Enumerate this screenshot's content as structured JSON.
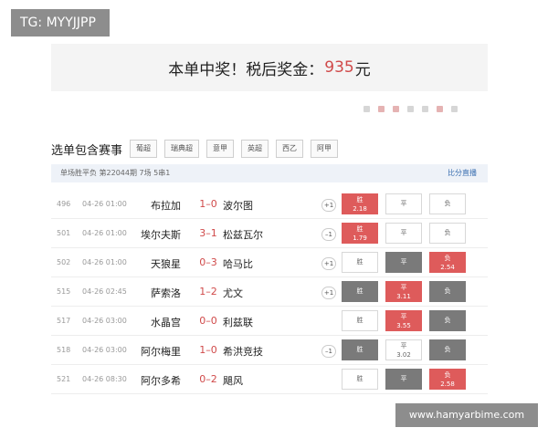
{
  "watermark": {
    "tg": "TG: MYYJJPP",
    "site": "www.hamyarbime.com"
  },
  "banner": {
    "prefix": "本单中奖！税后奖金：",
    "amount": "935",
    "suffix": "元"
  },
  "section": {
    "title": "选单包含赛事",
    "leagues": [
      "葡超",
      "瑞典超",
      "意甲",
      "英超",
      "西乙",
      "阿甲"
    ]
  },
  "subheader": {
    "left": "单场胜平负 第22044期 7场 5串1",
    "right": "比分直播"
  },
  "colors": {
    "red": "#de5b5b",
    "gray": "#7a7a7a",
    "score_red": "#d04a4a"
  },
  "matches": [
    {
      "num": "496",
      "time": "04-26 01:00",
      "home": "布拉加",
      "score": "1–0",
      "away": "波尔图",
      "hcap": "+1",
      "odds": [
        {
          "label": "胜",
          "value": "2.18",
          "state": "red"
        },
        {
          "label": "平",
          "value": "",
          "state": "white"
        },
        {
          "label": "负",
          "value": "",
          "state": "white"
        }
      ]
    },
    {
      "num": "501",
      "time": "04-26 01:00",
      "home": "埃尔夫斯",
      "score": "3–1",
      "away": "松兹瓦尔",
      "hcap": "–1",
      "odds": [
        {
          "label": "胜",
          "value": "1.79",
          "state": "red"
        },
        {
          "label": "平",
          "value": "",
          "state": "white"
        },
        {
          "label": "负",
          "value": "",
          "state": "white"
        }
      ]
    },
    {
      "num": "502",
      "time": "04-26 01:00",
      "home": "天狼星",
      "score": "0–3",
      "away": "哈马比",
      "hcap": "+1",
      "odds": [
        {
          "label": "胜",
          "value": "",
          "state": "white"
        },
        {
          "label": "平",
          "value": "",
          "state": "gray"
        },
        {
          "label": "负",
          "value": "2.54",
          "state": "red"
        }
      ]
    },
    {
      "num": "515",
      "time": "04-26 02:45",
      "home": "萨索洛",
      "score": "1–2",
      "away": "尤文",
      "hcap": "+1",
      "odds": [
        {
          "label": "胜",
          "value": "",
          "state": "gray"
        },
        {
          "label": "平",
          "value": "3.11",
          "state": "red"
        },
        {
          "label": "负",
          "value": "",
          "state": "gray"
        }
      ]
    },
    {
      "num": "517",
      "time": "04-26 03:00",
      "home": "水晶宫",
      "score": "0–0",
      "away": "利兹联",
      "hcap": "",
      "odds": [
        {
          "label": "胜",
          "value": "",
          "state": "white"
        },
        {
          "label": "平",
          "value": "3.55",
          "state": "red"
        },
        {
          "label": "负",
          "value": "",
          "state": "gray"
        }
      ]
    },
    {
      "num": "518",
      "time": "04-26 03:00",
      "home": "阿尔梅里",
      "score": "1–0",
      "away": "希洪竞技",
      "hcap": "–1",
      "odds": [
        {
          "label": "胜",
          "value": "",
          "state": "gray"
        },
        {
          "label": "平",
          "value": "3.02",
          "state": "white"
        },
        {
          "label": "负",
          "value": "",
          "state": "gray"
        }
      ]
    },
    {
      "num": "521",
      "time": "04-26 08:30",
      "home": "阿尔多希",
      "score": "0–2",
      "away": "飓风",
      "hcap": "",
      "odds": [
        {
          "label": "胜",
          "value": "",
          "state": "white"
        },
        {
          "label": "平",
          "value": "",
          "state": "gray"
        },
        {
          "label": "负",
          "value": "2.58",
          "state": "red"
        }
      ]
    }
  ]
}
